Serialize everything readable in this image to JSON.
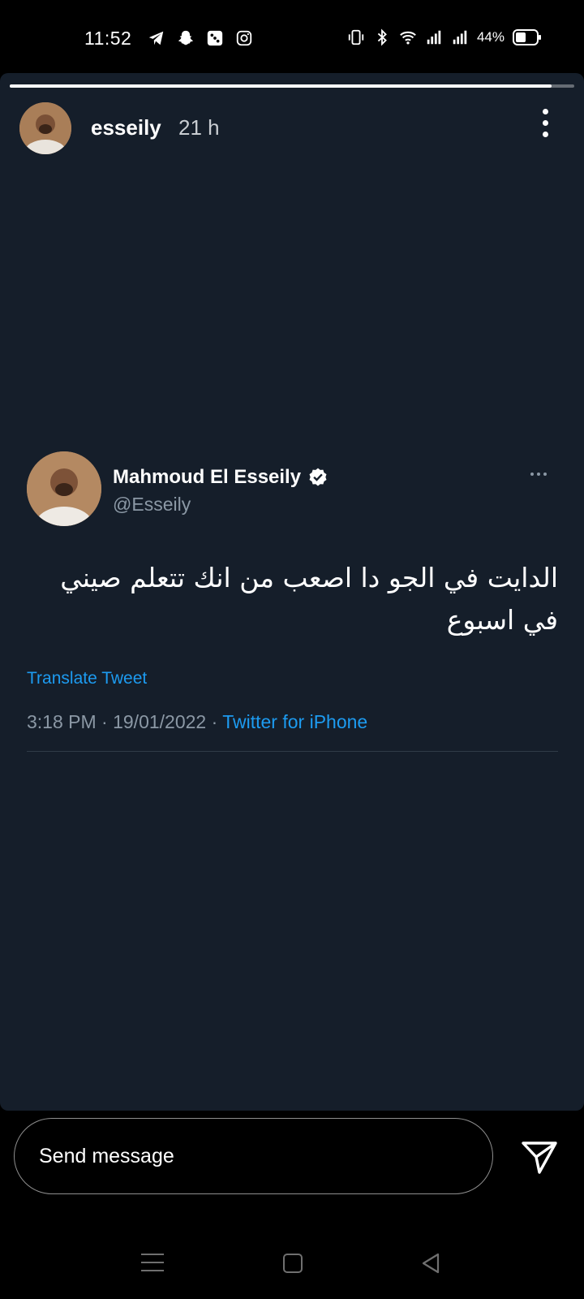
{
  "status_bar": {
    "time": "11:52",
    "left_icons": [
      "telegram-icon",
      "snapchat-icon",
      "dice-icon",
      "instagram-icon"
    ],
    "right_icons": [
      "vibrate-icon",
      "bluetooth-icon",
      "wifi-icon",
      "signal-icon",
      "signal-icon",
      "battery-icon"
    ],
    "battery": "44%"
  },
  "story": {
    "progress": 0.96,
    "username": "esseily",
    "time_ago": "21 h"
  },
  "tweet": {
    "display_name": "Mahmoud El Esseily",
    "handle": "@Esseily",
    "text_line1": "الدايت في الجو دا اصعب من  انك تتعلم صيني",
    "text_line2": "في اسبوع",
    "translate_label": "Translate Tweet",
    "timestamp": "3:18 PM · 19/01/2022 · ",
    "source": "Twitter for iPhone"
  },
  "message_bar": {
    "placeholder": "Send message"
  },
  "colors": {
    "story_bg": "#151e2a",
    "link_blue": "#1d9bf0",
    "muted": "#8b98a5"
  }
}
